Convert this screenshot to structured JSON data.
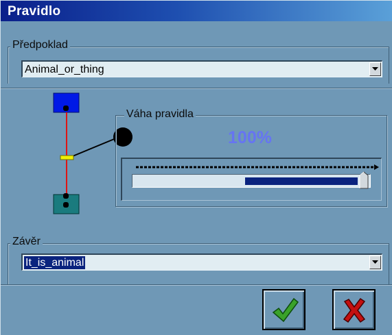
{
  "window": {
    "title": "Pravidlo"
  },
  "premise": {
    "legend": "Předpoklad",
    "selected": "Animal_or_thing"
  },
  "weight": {
    "legend": "Váha pravidla",
    "percent_text": "100%",
    "value_fraction": 1.0
  },
  "conclusion": {
    "legend": "Závěr",
    "selected": "It_is_animal"
  },
  "buttons": {
    "ok_icon": "green-check-icon",
    "cancel_icon": "red-x-icon"
  },
  "colors": {
    "title_gradient_start": "#0a1f8a",
    "title_gradient_end": "#5aa0d8",
    "background": "#6f98b6",
    "percent_text": "#6674f2",
    "slider_fill": "#0a237e",
    "premise_node": "#0019e6",
    "conclusion_node": "#1a7b7e",
    "rule_line": "#e01414",
    "weight_marker": "#f0f000",
    "ok_check": "#3aa22a",
    "cancel_x": "#c41010"
  }
}
